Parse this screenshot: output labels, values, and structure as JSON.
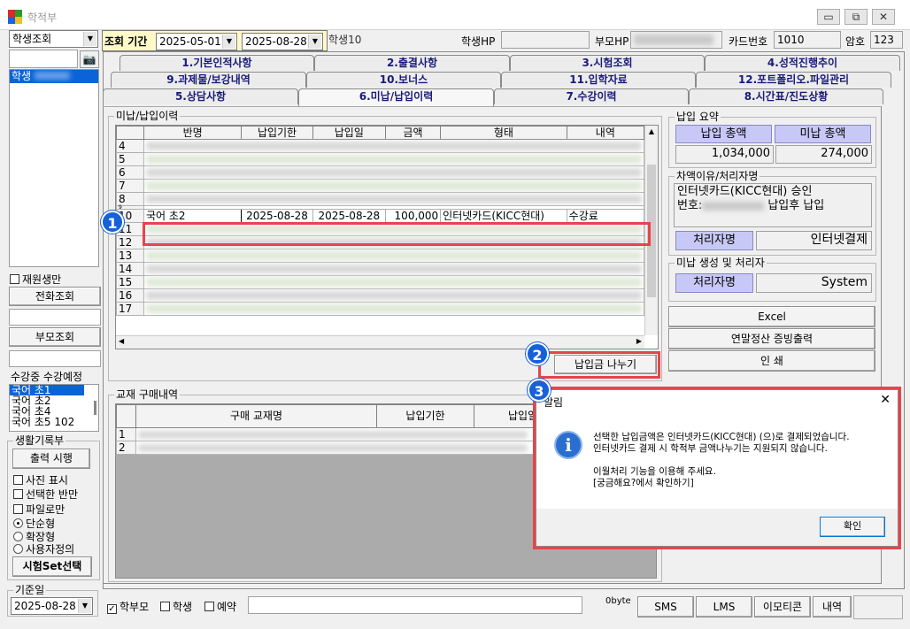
{
  "window": {
    "title": "학적부",
    "btn_min": "▭",
    "btn_max": "⧉",
    "btn_close": "✕"
  },
  "header": {
    "period_label": "조회 기간",
    "date_from": "2025-05-01",
    "date_to": "2025-08-28",
    "student_num_text": "학생10",
    "student_hp_label": "학생HP",
    "parent_hp_label": "부모HP",
    "card_label": "카드번호",
    "card_value": "1010",
    "password_label": "암호",
    "password_value": "123"
  },
  "left": {
    "search_mode": "학생조회",
    "student_list_item": "학생",
    "rejoin_label": "재원생만",
    "phone_btn": "전화조회",
    "parent_btn": "부모조회",
    "course_status": "수강중 수강예정",
    "course_items": [
      "국어 초1",
      "국어 초2",
      "국어 초4",
      "국어 초5 102"
    ],
    "record_group": "생활기록부",
    "print_btn": "출력 시행",
    "opt_photo": "사진 표시",
    "opt_selected": "선택한 반만",
    "opt_file": "파일로만",
    "opt_simple": "단순형",
    "opt_extended": "확장형",
    "opt_custom": "사용자정의",
    "exam_set_btn": "시험Set선택",
    "base_date_label": "기준일",
    "base_date": "2025-08-28"
  },
  "tabs": {
    "row1": [
      "1.기본인적사항",
      "2.출결사항",
      "3.시험조회",
      "4.성적진행추이"
    ],
    "row2": [
      "9.과제물/보강내역",
      "10.보너스",
      "11.입학자료",
      "12.포트폴리오.파일관리"
    ],
    "row3": [
      "5.상담사항",
      "6.미납/납입이력",
      "7.수강이력",
      "8.시간표/진도상황"
    ]
  },
  "payment_history": {
    "group_title": "미납/납입이력",
    "columns": [
      "반명",
      "납입기한",
      "납입일",
      "금액",
      "형태",
      "내역"
    ],
    "row_numbers": [
      "4",
      "5",
      "6",
      "7",
      "8",
      "9",
      "10",
      "11",
      "12",
      "13",
      "14",
      "15",
      "16",
      "17"
    ],
    "highlight_row": {
      "num": "10",
      "class": "국어 초2",
      "due": "2025-08-28",
      "paid": "2025-08-28",
      "amount": "100,000",
      "type": "인터넷카드(KICC현대)",
      "detail": "수강료"
    },
    "split_btn": "납입금 나누기"
  },
  "summary": {
    "group_title": "납입 요약",
    "paid_total_label": "납입 총액",
    "unpaid_total_label": "미납 총액",
    "paid_total": "1,034,000",
    "unpaid_total": "274,000",
    "diff_group": "차액이유/처리자명",
    "diff_text_line1": "인터넷카드(KICC현대) 승인",
    "diff_text_line2a": "번호:",
    "diff_text_line2b": "납입후 납입",
    "handler_label": "처리자명",
    "handler_value": "인터넷결제",
    "unpaid_group": "미납 생성 및 처리자",
    "handler2_label": "처리자명",
    "handler2_value": "System",
    "excel_btn": "Excel",
    "year_end_btn": "연말정산 증빙출력",
    "print_btn": "인   쇄"
  },
  "textbook": {
    "group_title": "교재 구매내역",
    "columns": [
      "구매 교재명",
      "납입기한",
      "납입일"
    ],
    "row_numbers": [
      "1",
      "2"
    ]
  },
  "dialog": {
    "title": "알림",
    "line1": "선택한 납입금액은 인터넷카드(KICC현대) (으)로 결제되었습니다.",
    "line2": "인터넷카드 결제 시 학적부 금액나누기는 지원되지 않습니다.",
    "line3": "이월처리 기능을 이용해 주세요.",
    "line4": "[궁금해요?에서 확인하기]",
    "ok_btn": "확인",
    "close": "✕"
  },
  "bottom": {
    "parent_label": "학부모",
    "student_label": "학생",
    "reserve_label": "예약",
    "byte_label": "0byte",
    "sms_btn": "SMS",
    "lms_btn": "LMS",
    "emoticon_btn": "이모티콘",
    "history_btn": "내역"
  },
  "annotations": {
    "b1": "1",
    "b2": "2",
    "b3": "3"
  },
  "colors": {
    "highlight": "#e8434b",
    "badge": "#1760d8",
    "selection": "#0a64d8",
    "summary_header": "#c8c8f6"
  }
}
